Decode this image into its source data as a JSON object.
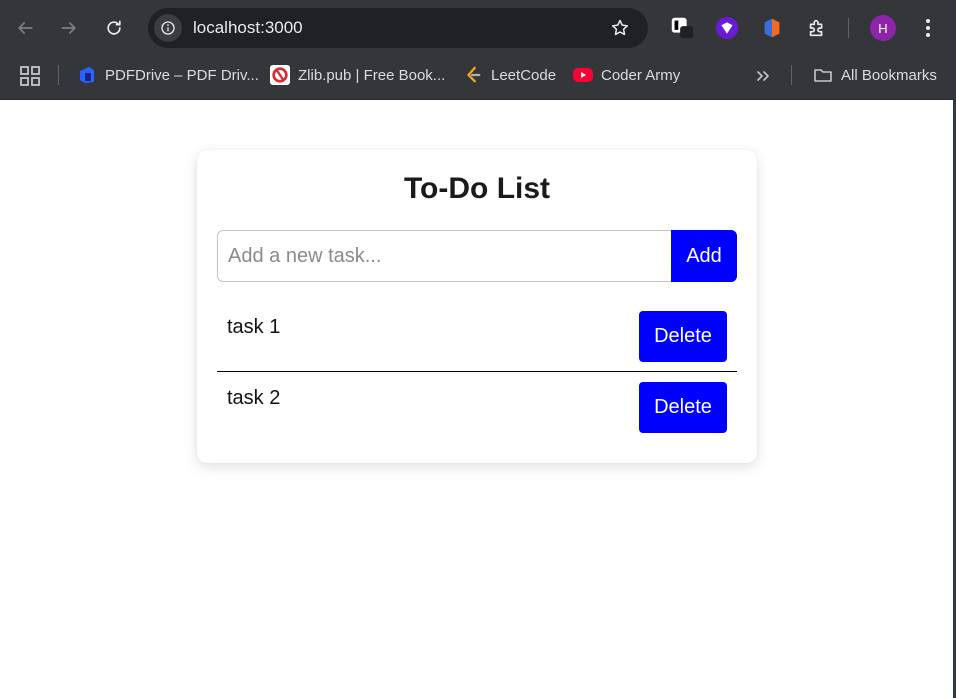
{
  "browser": {
    "url": "localhost:3000",
    "avatar_initial": "H",
    "bookmarks": [
      {
        "label": "PDFDrive – PDF Driv...",
        "icon": "pdfdrive-icon"
      },
      {
        "label": "Zlib.pub | Free Book...",
        "icon": "zlib-icon"
      },
      {
        "label": "LeetCode",
        "icon": "leetcode-icon"
      },
      {
        "label": "Coder Army",
        "icon": "youtube-icon"
      }
    ],
    "all_bookmarks_label": "All Bookmarks"
  },
  "app": {
    "title": "To-Do List",
    "input_placeholder": "Add a new task...",
    "input_value": "",
    "add_label": "Add",
    "tasks": [
      {
        "text": "task 1",
        "delete_label": "Delete"
      },
      {
        "text": "task 2",
        "delete_label": "Delete"
      }
    ]
  },
  "colors": {
    "button": "#0000ff",
    "chrome": "#35363a",
    "avatar": "#8e24aa"
  }
}
